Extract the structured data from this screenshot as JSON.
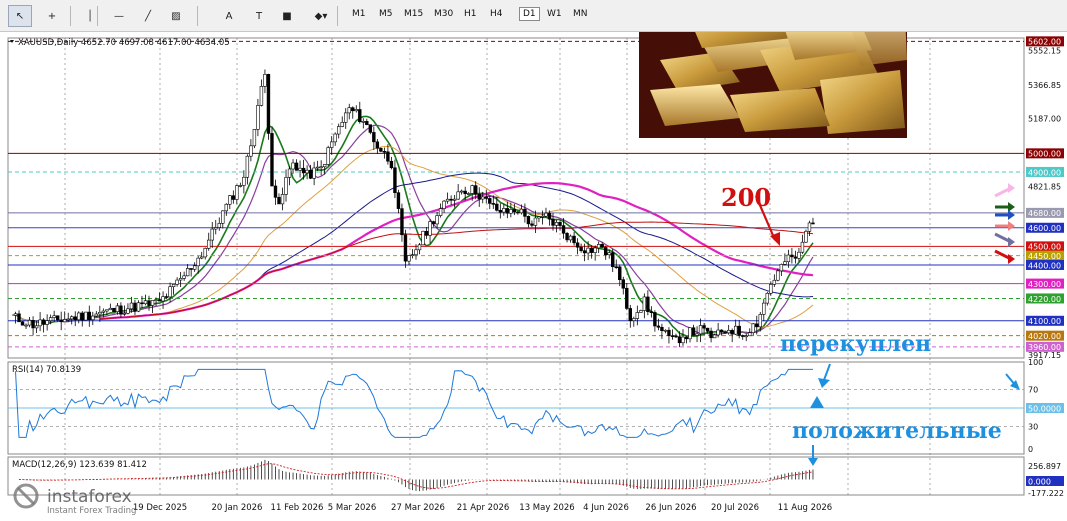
{
  "toolbar": {
    "tools": [
      {
        "icon": "cursor-icon",
        "glyph": "↖"
      },
      {
        "icon": "crosshair-icon",
        "glyph": "+"
      },
      {
        "icon": "vertical-line-icon",
        "glyph": "│"
      },
      {
        "icon": "horizontal-line-icon",
        "glyph": "—"
      },
      {
        "icon": "trend-line-icon",
        "glyph": "╱"
      },
      {
        "icon": "channel-icon",
        "glyph": "▨"
      },
      {
        "icon": "text-icon",
        "glyph": "A"
      },
      {
        "icon": "label-icon",
        "glyph": "T"
      },
      {
        "icon": "rectangle-icon",
        "glyph": "■"
      },
      {
        "icon": "shapes-icon",
        "glyph": "◆▾"
      }
    ],
    "timeframes": [
      "M1",
      "M5",
      "M15",
      "M30",
      "H1",
      "H4",
      "D1",
      "W1",
      "MN"
    ],
    "selected_timeframe": "D1"
  },
  "chart_data": {
    "type": "candlestick",
    "symbol_header": "XAUUSD,Daily  4652.70 4697.08 4617.00 4634.05",
    "x_tick_labels": [
      "19 Dec 2025",
      "20 Jan 2026",
      "11 Feb 2026",
      "5 Mar 2026",
      "27 Mar 2026",
      "21 Apr 2026",
      "13 May 2026",
      "4 Jun 2026",
      "26 Jun 2026",
      "20 Jul 2026",
      "11 Aug 2026"
    ],
    "y_tick_labels": [
      "5552.15",
      "5366.85",
      "5187.00",
      "4821.85",
      "3917.15"
    ],
    "ylim": [
      3900,
      5620
    ],
    "ohlc_close_path": [
      [
        0,
        4120
      ],
      [
        6,
        4080
      ],
      [
        12,
        4100
      ],
      [
        18,
        4120
      ],
      [
        24,
        4140
      ],
      [
        30,
        4160
      ],
      [
        36,
        4180
      ],
      [
        42,
        4200
      ],
      [
        48,
        4320
      ],
      [
        54,
        4460
      ],
      [
        60,
        4680
      ],
      [
        66,
        4880
      ],
      [
        68,
        5050
      ],
      [
        70,
        5260
      ],
      [
        72,
        5420
      ],
      [
        74,
        4850
      ],
      [
        76,
        4700
      ],
      [
        78,
        4860
      ],
      [
        80,
        4950
      ],
      [
        84,
        4880
      ],
      [
        88,
        4920
      ],
      [
        92,
        5100
      ],
      [
        96,
        5240
      ],
      [
        100,
        5180
      ],
      [
        104,
        5040
      ],
      [
        108,
        4950
      ],
      [
        112,
        4400
      ],
      [
        116,
        4520
      ],
      [
        120,
        4650
      ],
      [
        124,
        4740
      ],
      [
        128,
        4810
      ],
      [
        132,
        4800
      ],
      [
        136,
        4720
      ],
      [
        140,
        4680
      ],
      [
        144,
        4700
      ],
      [
        148,
        4620
      ],
      [
        152,
        4660
      ],
      [
        156,
        4600
      ],
      [
        160,
        4520
      ],
      [
        164,
        4480
      ],
      [
        168,
        4500
      ],
      [
        172,
        4380
      ],
      [
        176,
        4120
      ],
      [
        180,
        4200
      ],
      [
        184,
        4060
      ],
      [
        188,
        3990
      ],
      [
        192,
        4030
      ],
      [
        196,
        4050
      ],
      [
        200,
        4010
      ],
      [
        204,
        4060
      ],
      [
        208,
        4030
      ],
      [
        212,
        4090
      ],
      [
        216,
        4300
      ],
      [
        220,
        4420
      ],
      [
        224,
        4450
      ],
      [
        226,
        4580
      ],
      [
        228,
        4650
      ]
    ],
    "moving_averages": [
      {
        "name": "fast-green",
        "color": "#1a7a1a"
      },
      {
        "name": "purple",
        "color": "#8a3f9e"
      },
      {
        "name": "orange",
        "color": "#e0a040"
      },
      {
        "name": "navy",
        "color": "#1a1a8c"
      },
      {
        "name": "magenta",
        "color": "#e020c0"
      },
      {
        "name": "red-200",
        "color": "#c01010"
      }
    ],
    "levels": [
      {
        "value": 5602.0,
        "label": "5602.00",
        "style": "dashed",
        "color": "#8b0000",
        "label_bg": "#8b0000"
      },
      {
        "value": 5000.0,
        "label": "5000.00",
        "style": "solid",
        "color": "#8b0000",
        "label_bg": "#8b0000"
      },
      {
        "value": 4900.0,
        "label": "4900.00",
        "style": "dashed",
        "color": "#4fc8c8",
        "label_bg": "#4fc8c8"
      },
      {
        "value": 4680.0,
        "label": "4680.00",
        "style": "solid",
        "color": "#7070a0",
        "label_bg": "#9999b0"
      },
      {
        "value": 4600.0,
        "label": "4600.00",
        "style": "solid",
        "color": "#4040c0",
        "label_bg": "#2030c0"
      },
      {
        "value": 4500.0,
        "label": "4500.00",
        "style": "solid",
        "color": "#d01010",
        "label_bg": "#d01010"
      },
      {
        "value": 4450.0,
        "label": "4450.00",
        "style": "dashed",
        "color": "#b8a000",
        "label_bg": "#b8a000"
      },
      {
        "value": 4400.0,
        "label": "4400.00",
        "style": "solid",
        "color": "#2030c0",
        "label_bg": "#2030c0"
      },
      {
        "value": 4300.0,
        "label": "4300.00",
        "style": "solid",
        "color": "#e020c0",
        "label_bg": "#e020c0"
      },
      {
        "value": 4220.0,
        "label": "4220.00",
        "style": "dashed",
        "color": "#30a030",
        "label_bg": "#30a030"
      },
      {
        "value": 4100.0,
        "label": "4100.00",
        "style": "solid",
        "color": "#2030c0",
        "label_bg": "#2030c0"
      },
      {
        "value": 4020.0,
        "label": "4020.00",
        "style": "dashed",
        "color": "#b87810",
        "label_bg": "#b87810"
      },
      {
        "value": 3960.0,
        "label": "3960.00",
        "style": "dashed",
        "color": "#d060d0",
        "label_bg": "#d060d0"
      }
    ],
    "annotations": {
      "ma200_label": "200",
      "overbought_label": "перекуплен",
      "positive_label": "положительные"
    },
    "rsi": {
      "header": "RSI(14) 70.8139",
      "value": 70.8139,
      "ylim": [
        0,
        100
      ],
      "y_tick_labels": [
        "100",
        "70",
        "50.0000",
        "30",
        "0"
      ],
      "color": "#1e78d8"
    },
    "macd": {
      "header": "MACD(12,26,9) 123.639 81.412",
      "y_tick_labels": [
        "256.897",
        "0.000",
        "-177.222"
      ],
      "ylim": [
        -177.222,
        256.897
      ]
    }
  },
  "watermark": {
    "brand": "instaforex",
    "tagline": "Instant Forex Trading"
  },
  "inset_image": {
    "icon": "gold-bars-photo"
  }
}
